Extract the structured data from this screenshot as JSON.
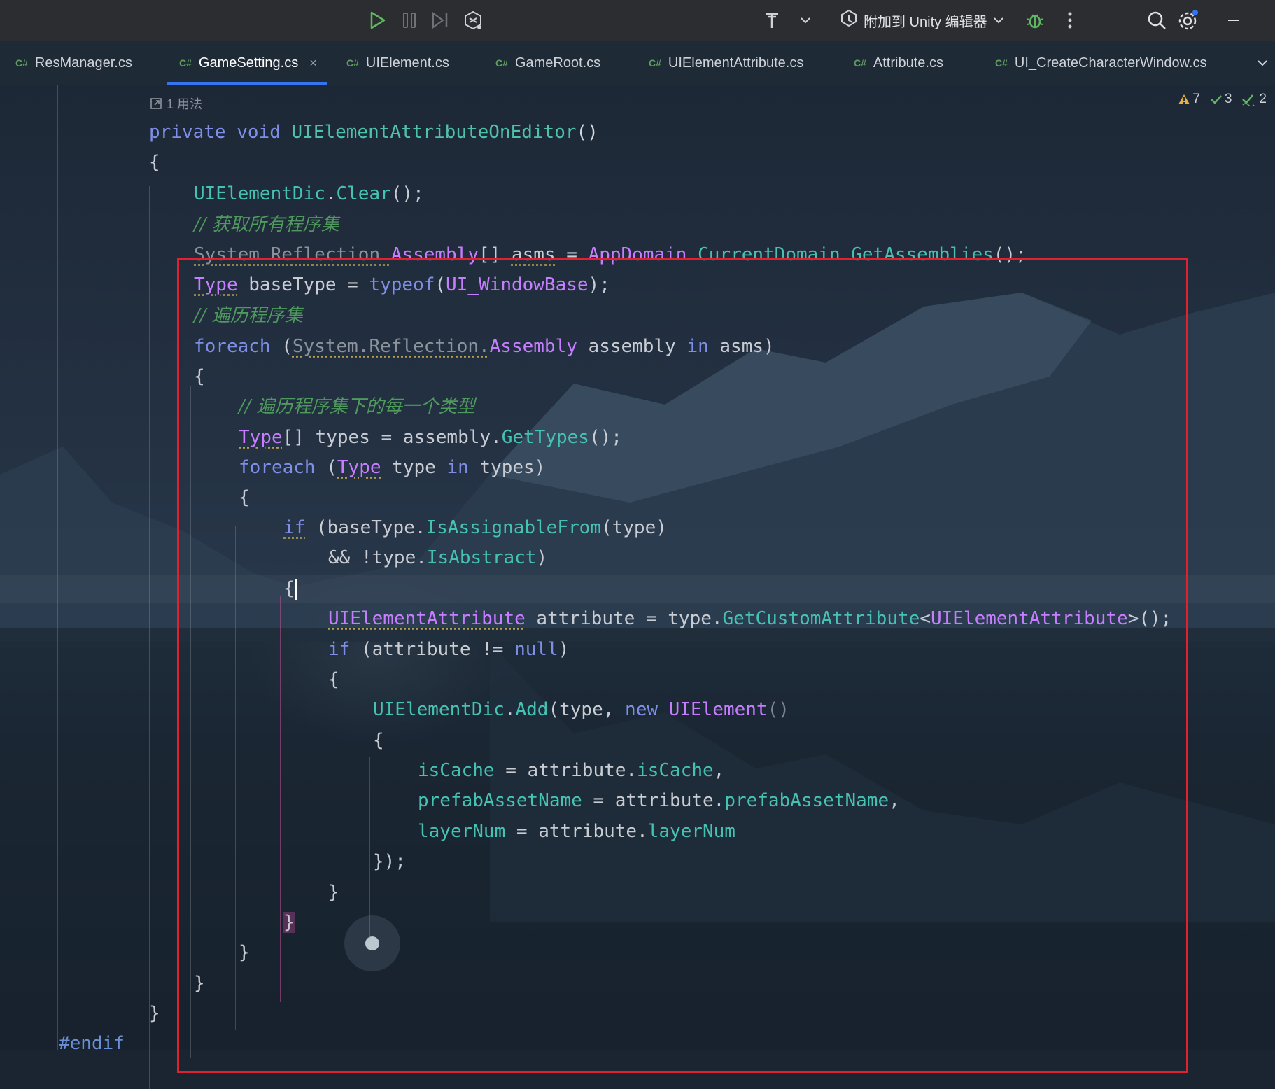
{
  "toolbar": {
    "attach_label": "附加到 Unity 编辑器",
    "icons": [
      "run-icon",
      "pause-icon",
      "step-icon",
      "unity-debug-icon",
      "build-icon",
      "dropdown-icon",
      "unity-icon",
      "bug-icon",
      "more-icon",
      "search-icon",
      "settings-icon",
      "minimize-icon"
    ]
  },
  "tabs": [
    {
      "badge": "C#",
      "label": "ResManager.cs"
    },
    {
      "badge": "C#",
      "label": "GameSetting.cs",
      "active": true,
      "close": "×"
    },
    {
      "badge": "C#",
      "label": "UIElement.cs"
    },
    {
      "badge": "C#",
      "label": "GameRoot.cs"
    },
    {
      "badge": "C#",
      "label": "UIElementAttribute.cs"
    },
    {
      "badge": "C#",
      "label": "Attribute.cs"
    },
    {
      "badge": "C#",
      "label": "UI_CreateCharacterWindow.cs"
    }
  ],
  "editor": {
    "usages": "1 用法",
    "inspections": {
      "warnings": "7",
      "ok": "3",
      "typos": "2"
    },
    "code": {
      "sig_private": "private",
      "sig_void": "void",
      "sig_name": "UIElementAttributeOnEditor",
      "sig_parens": "()",
      "open_brace": "{",
      "close_brace": "}",
      "l1_obj": "UIElementDic",
      "l1_dot": ".",
      "l1_m": "Clear",
      "l1_end": "();",
      "c1": "// 获取所有程序集",
      "l3_ns": "System.Reflection.",
      "l3_ty": "Assembly",
      "l3_arr": "[] ",
      "l3_var": "asms",
      "l3_eq": " = ",
      "l3_ad": "AppDomain",
      "l3_dot": ".",
      "l3_cd": "CurrentDomain",
      "l3_dot2": ".",
      "l3_ga": "GetAssemblies",
      "l3_end": "();",
      "l4_ty": "Type",
      "l4_rest": " baseType = ",
      "l4_typeof": "typeof",
      "l4_p1": "(",
      "l4_cls": "UI_WindowBase",
      "l4_end": ");",
      "c2": "// 遍历程序集",
      "l6_fe": "foreach",
      "l6_p": " (",
      "l6_ns": "System.Reflection.",
      "l6_ty": "Assembly",
      "l6_var": " assembly ",
      "l6_in": "in",
      "l6_end": " asms)",
      "c3": "// 遍历程序集下的每一个类型",
      "l9_ty": "Type",
      "l9_rest": "[] types = assembly.",
      "l9_m": "GetTypes",
      "l9_end": "();",
      "l10_fe": "foreach",
      "l10_p": " (",
      "l10_ty": "Type",
      "l10_var": " type ",
      "l10_in": "in",
      "l10_end": " types)",
      "l12_if": "if",
      "l12_p": " (baseType.",
      "l12_m": "IsAssignableFrom",
      "l12_end": "(type)",
      "l13_a": "&& !type.",
      "l13_p": "IsAbstract",
      "l13_end": ")",
      "l15_ty": "UIElementAttribute",
      "l15_rest": " attribute = type.",
      "l15_m": "GetCustomAttribute",
      "l15_lt": "<",
      "l15_ty2": "UIElementAttribute",
      "l15_end": ">();",
      "l16_if": "if",
      "l16_rest": " (attribute != ",
      "l16_null": "null",
      "l16_end": ")",
      "l18_obj": "UIElementDic",
      "l18_dot": ".",
      "l18_m": "Add",
      "l18_rest": "(type, ",
      "l18_new": "new",
      "l18_sp": " ",
      "l18_ty": "UIElement",
      "l18_par": "()",
      "l20_p": "isCache",
      "l20_rest": " = attribute.",
      "l20_v": "isCache",
      "l20_end": ",",
      "l21_p": "prefabAssetName",
      "l21_rest": " = attribute.",
      "l21_v": "prefabAssetName",
      "l21_end": ",",
      "l22_p": "layerNum",
      "l22_rest": " = attribute.",
      "l22_v": "layerNum",
      "l23": "});",
      "endif": "#endif"
    }
  },
  "colors": {
    "highlight_box": "#e0212f",
    "tab_underline": "#3574f0",
    "keyword": "#7f8fe8",
    "type": "#c77dff",
    "method": "#4fc1a9",
    "comment": "#4f9a5d"
  }
}
